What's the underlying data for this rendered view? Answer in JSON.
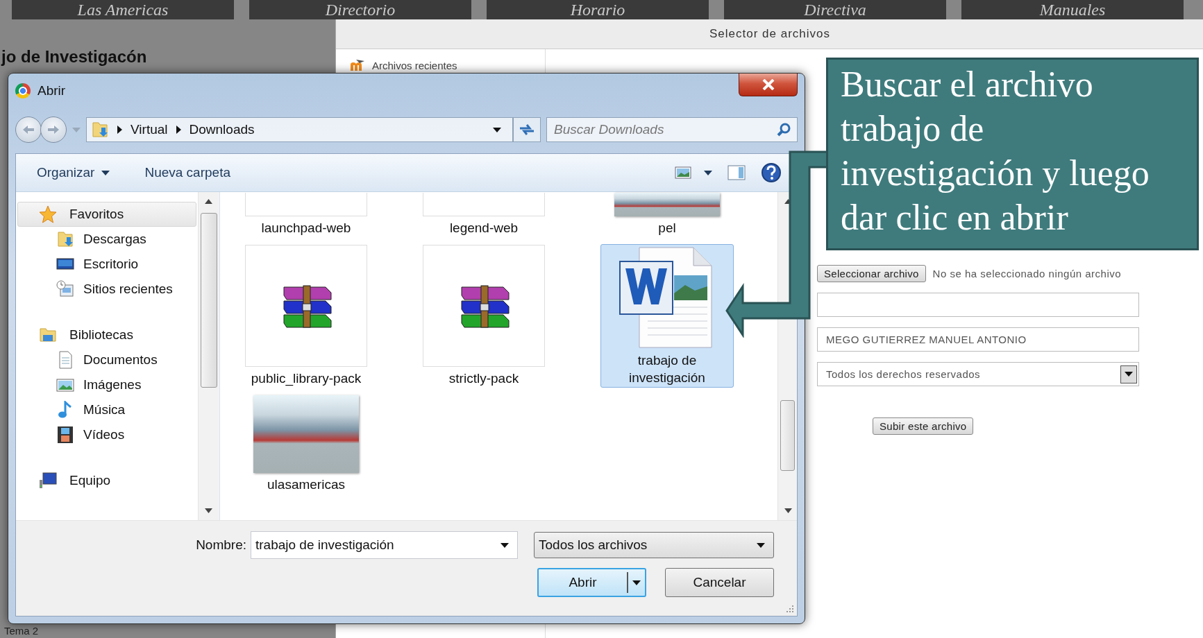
{
  "background_page": {
    "nav_tabs": [
      "Las Americas",
      "Directorio",
      "Horario",
      "Directiva",
      "Manuales"
    ],
    "heading": "jo de Investigacón",
    "footer_text": "Tema 2"
  },
  "file_picker": {
    "title": "Selector de archivos",
    "sidebar_items": [
      "Archivos recientes"
    ],
    "choose_button": "Seleccionar archivo",
    "choose_status": "No se ha seleccionado ningún archivo",
    "fields": [
      {
        "kind": "text"
      },
      {
        "kind": "text",
        "value": "MEGO GUTIERREZ MANUEL ANTONIO"
      },
      {
        "kind": "select",
        "value": "Todos los derechos reservados"
      }
    ],
    "upload_button": "Subir este archivo"
  },
  "open_dialog": {
    "title": "Abrir",
    "path": [
      "Virtual",
      "Downloads"
    ],
    "search": {
      "placeholder": "Buscar Downloads"
    },
    "toolbar": [
      {
        "label": "Organizar",
        "kind": "menu"
      },
      {
        "label": "Nueva carpeta",
        "kind": "plain"
      }
    ],
    "nav_pane": [
      {
        "label": "Favoritos",
        "selected": true,
        "children": [
          {
            "label": "Descargas",
            "selected": false
          },
          {
            "label": "Escritorio",
            "selected": false
          },
          {
            "label": "Sitios recientes",
            "selected": false
          }
        ]
      },
      {
        "label": "Bibliotecas",
        "selected": false,
        "children": [
          {
            "label": "Documentos",
            "selected": false
          },
          {
            "label": "Imágenes",
            "selected": false
          },
          {
            "label": "Música",
            "selected": false
          },
          {
            "label": "Vídeos",
            "selected": false
          }
        ]
      },
      {
        "label": "Equipo",
        "selected": false
      }
    ],
    "files": [
      {
        "name": "launchpad-web",
        "kind": "blank",
        "selected": false
      },
      {
        "name": "legend-web",
        "kind": "blank",
        "selected": false
      },
      {
        "name": "pel",
        "kind": "photo",
        "selected": false
      },
      {
        "name": "public_library-pack",
        "kind": "archive",
        "selected": false
      },
      {
        "name": "strictly-pack",
        "kind": "archive",
        "selected": false
      },
      {
        "name": "trabajo de investigación",
        "kind": "document",
        "selected": true
      },
      {
        "name": "ulasamericas",
        "kind": "photo",
        "selected": false
      }
    ],
    "filename": {
      "label": "Nombre:",
      "value": "trabajo de investigación"
    },
    "filetype": "Todos los archivos",
    "buttons": [
      {
        "label": "Abrir",
        "kind": "split",
        "default": true
      },
      {
        "label": "Cancelar",
        "kind": "plain",
        "default": false
      }
    ]
  },
  "callout": {
    "text": "Buscar el archivo trabajo de investigación y luego dar clic en abrir"
  }
}
